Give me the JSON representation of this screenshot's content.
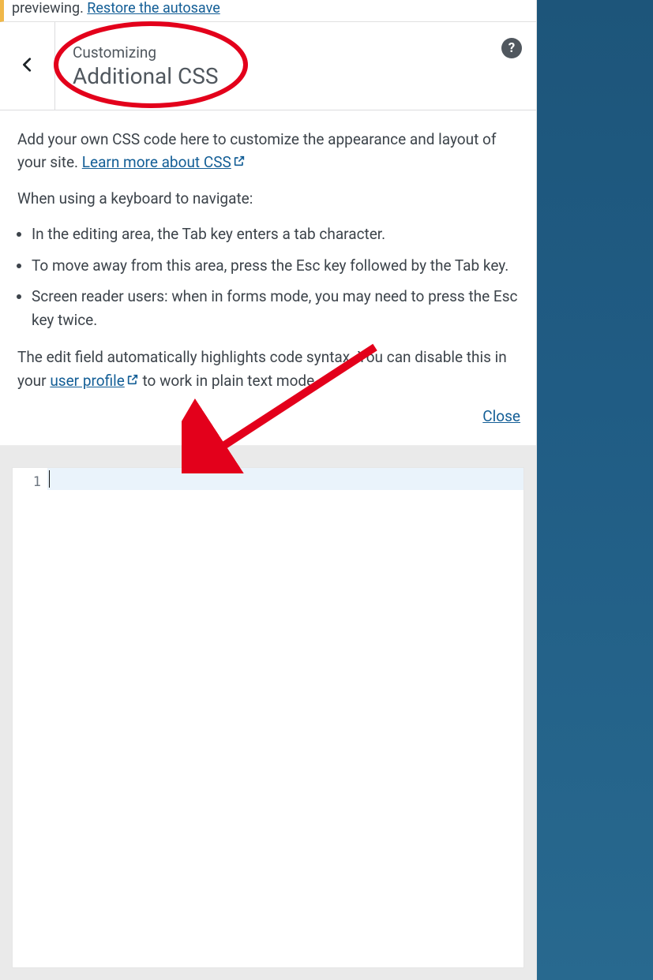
{
  "notice": {
    "text_prefix": "previewing. ",
    "link_text": "Restore the autosave"
  },
  "header": {
    "breadcrumb": "Customizing",
    "title": "Additional CSS"
  },
  "description": {
    "intro": "Add your own CSS code here to customize the appearance and layout of your site. ",
    "learn_more_label": "Learn more about CSS",
    "keyboard_heading": "When using a keyboard to navigate:",
    "bullets": [
      "In the editing area, the Tab key enters a tab character.",
      "To move away from this area, press the Esc key followed by the Tab key.",
      "Screen reader users: when in forms mode, you may need to press the Esc key twice."
    ],
    "syntax_prefix": "The edit field automatically highlights code syntax. You can disable this in your ",
    "user_profile_label": "user profile",
    "syntax_suffix": " to work in plain text mode.",
    "close_label": "Close"
  },
  "editor": {
    "line_number": "1",
    "content": ""
  },
  "buttons": {
    "help_glyph": "?"
  }
}
